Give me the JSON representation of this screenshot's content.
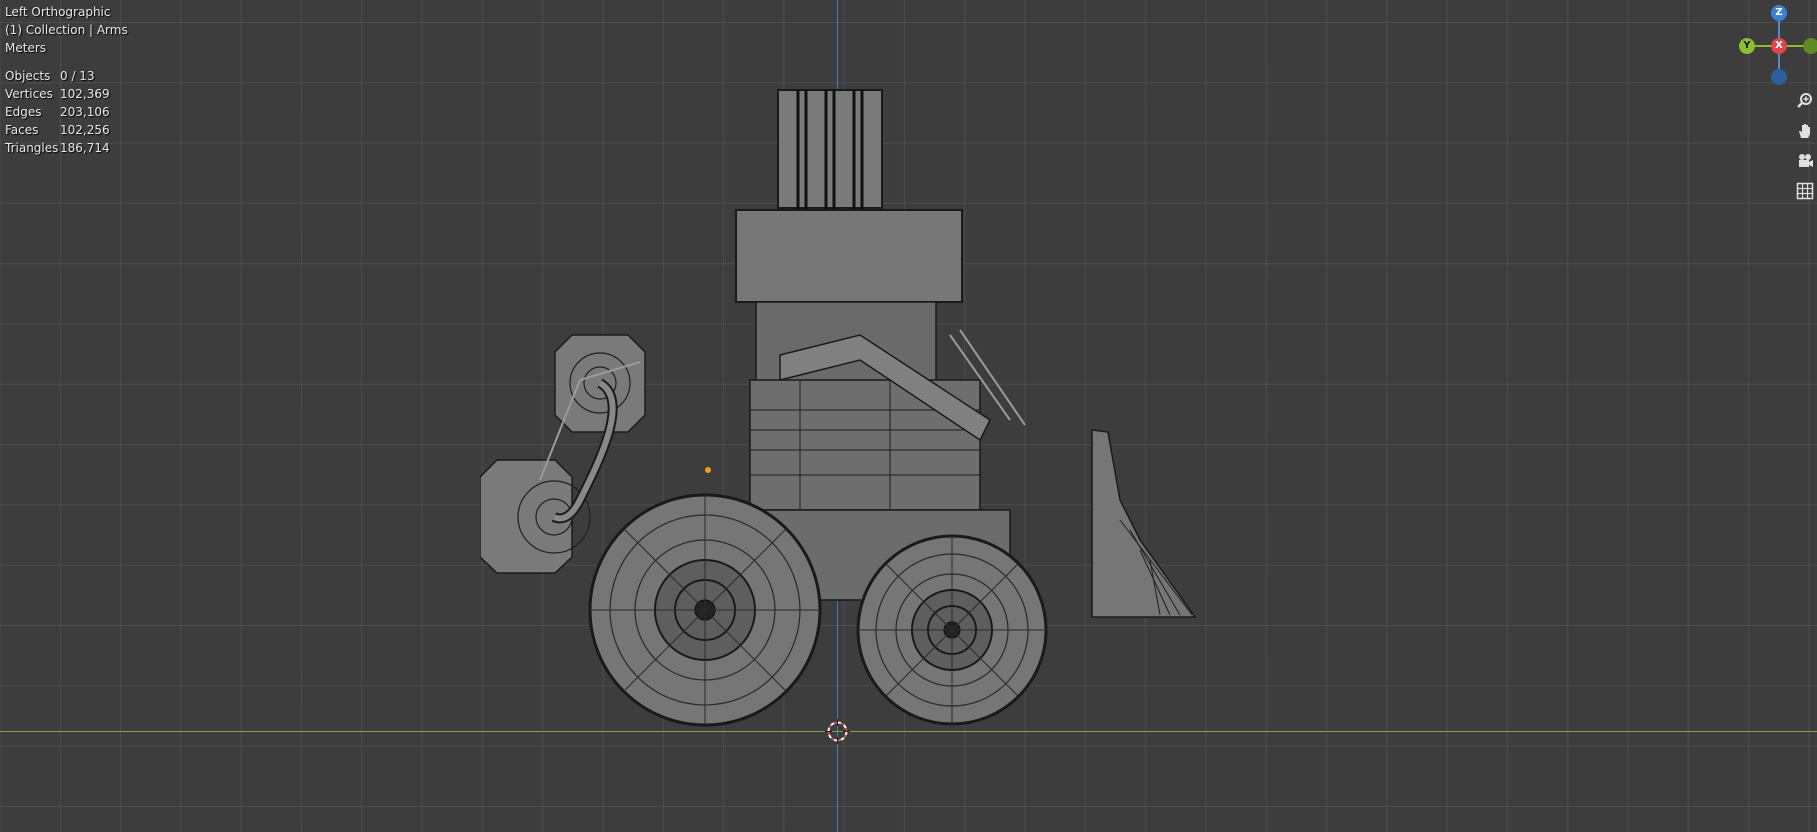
{
  "viewport": {
    "view_name": "Left Orthographic",
    "collection": "(1) Collection | Arms",
    "units": "Meters",
    "stats": [
      {
        "label": "Objects",
        "value": "0 / 13"
      },
      {
        "label": "Vertices",
        "value": "102,369"
      },
      {
        "label": "Edges",
        "value": "203,106"
      },
      {
        "label": "Faces",
        "value": "102,256"
      },
      {
        "label": "Triangles",
        "value": "186,714"
      }
    ]
  },
  "gizmo": {
    "z_label": "Z",
    "y_label": "Y",
    "x_label": "X"
  },
  "tools": {
    "zoom": "zoom-icon",
    "pan": "hand-icon",
    "camera": "camera-icon",
    "grid": "grid-icon"
  },
  "colors": {
    "background": "#3d3d3d",
    "z_axis": "#3f79c4",
    "y_axis": "#7fa642",
    "x_gizmo": "#e0454e",
    "y_gizmo": "#8bbf2f",
    "z_gizmo": "#3b82d6"
  }
}
